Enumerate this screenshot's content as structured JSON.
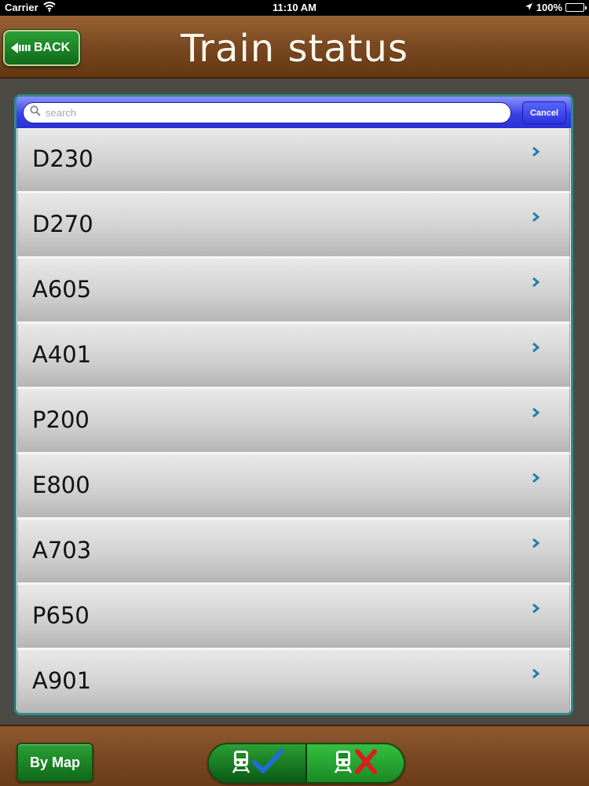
{
  "status_bar": {
    "carrier": "Carrier",
    "time": "11:10 AM",
    "battery": "100%",
    "battery_level": 1.0
  },
  "header": {
    "back_label": "BACK",
    "title": "Train status"
  },
  "search": {
    "placeholder": "search",
    "value": "",
    "cancel_label": "Cancel"
  },
  "trains": [
    {
      "label": "D230"
    },
    {
      "label": "D270"
    },
    {
      "label": "A605"
    },
    {
      "label": "A401"
    },
    {
      "label": "P200"
    },
    {
      "label": "E800"
    },
    {
      "label": "A703"
    },
    {
      "label": "P650"
    },
    {
      "label": "A901"
    }
  ],
  "footer": {
    "by_map_label": "By Map",
    "segments": [
      {
        "icon": "train-check-icon",
        "selected": true
      },
      {
        "icon": "train-cross-icon",
        "selected": false
      }
    ]
  },
  "colors": {
    "header_brown": "#7c4a22",
    "button_green": "#1a8a24",
    "search_blue": "#3a41e8",
    "panel_border": "#2e8a8a",
    "check_blue": "#1e6fd8",
    "cross_red": "#d81e1e"
  }
}
